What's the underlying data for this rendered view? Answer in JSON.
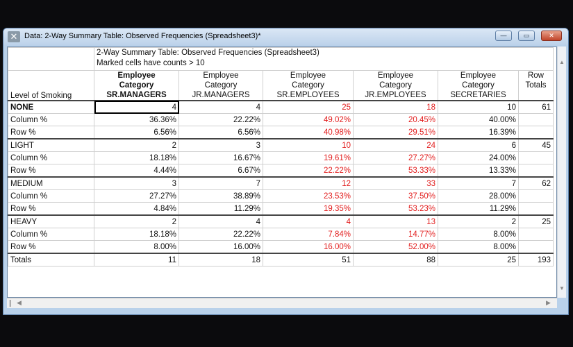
{
  "window": {
    "title": "Data: 2-Way Summary Table: Observed Frequencies (Spreadsheet3)*",
    "minimize_glyph": "—",
    "maximize_glyph": "▭",
    "close_glyph": "✕"
  },
  "table": {
    "heading": "2-Way Summary Table: Observed Frequencies (Spreadsheet3)",
    "note": "Marked cells have counts > 10",
    "row_header": "Level of Smoking",
    "columns": [
      {
        "line1": "Employee",
        "line2": "Category",
        "line3": "SR.MANAGERS"
      },
      {
        "line1": "Employee",
        "line2": "Category",
        "line3": "JR.MANAGERS"
      },
      {
        "line1": "Employee",
        "line2": "Category",
        "line3": "SR.EMPLOYEES"
      },
      {
        "line1": "Employee",
        "line2": "Category",
        "line3": "JR.EMPLOYEES"
      },
      {
        "line1": "Employee",
        "line2": "Category",
        "line3": "SECRETARIES"
      },
      {
        "line1": "Row",
        "line2": "Totals",
        "line3": ""
      }
    ],
    "rows": [
      {
        "label": "NONE",
        "cells": [
          "4",
          "4",
          "25",
          "18",
          "10",
          "61"
        ],
        "group": true
      },
      {
        "label": "Column %",
        "cells": [
          "36.36%",
          "22.22%",
          "49.02%",
          "20.45%",
          "40.00%",
          ""
        ]
      },
      {
        "label": "Row %",
        "cells": [
          "6.56%",
          "6.56%",
          "40.98%",
          "29.51%",
          "16.39%",
          ""
        ]
      },
      {
        "label": "LIGHT",
        "cells": [
          "2",
          "3",
          "10",
          "24",
          "6",
          "45"
        ],
        "group": true
      },
      {
        "label": "Column %",
        "cells": [
          "18.18%",
          "16.67%",
          "19.61%",
          "27.27%",
          "24.00%",
          ""
        ]
      },
      {
        "label": "Row %",
        "cells": [
          "4.44%",
          "6.67%",
          "22.22%",
          "53.33%",
          "13.33%",
          ""
        ]
      },
      {
        "label": "MEDIUM",
        "cells": [
          "3",
          "7",
          "12",
          "33",
          "7",
          "62"
        ],
        "group": true
      },
      {
        "label": "Column %",
        "cells": [
          "27.27%",
          "38.89%",
          "23.53%",
          "37.50%",
          "28.00%",
          ""
        ]
      },
      {
        "label": "Row %",
        "cells": [
          "4.84%",
          "11.29%",
          "19.35%",
          "53.23%",
          "11.29%",
          ""
        ]
      },
      {
        "label": "HEAVY",
        "cells": [
          "2",
          "4",
          "4",
          "13",
          "2",
          "25"
        ],
        "group": true
      },
      {
        "label": "Column %",
        "cells": [
          "18.18%",
          "22.22%",
          "7.84%",
          "14.77%",
          "8.00%",
          ""
        ]
      },
      {
        "label": "Row %",
        "cells": [
          "8.00%",
          "16.00%",
          "16.00%",
          "52.00%",
          "8.00%",
          ""
        ]
      },
      {
        "label": "Totals",
        "cells": [
          "11",
          "18",
          "51",
          "88",
          "25",
          "193"
        ],
        "group": true
      }
    ]
  },
  "colors": {
    "marked": "#e21d1d"
  }
}
